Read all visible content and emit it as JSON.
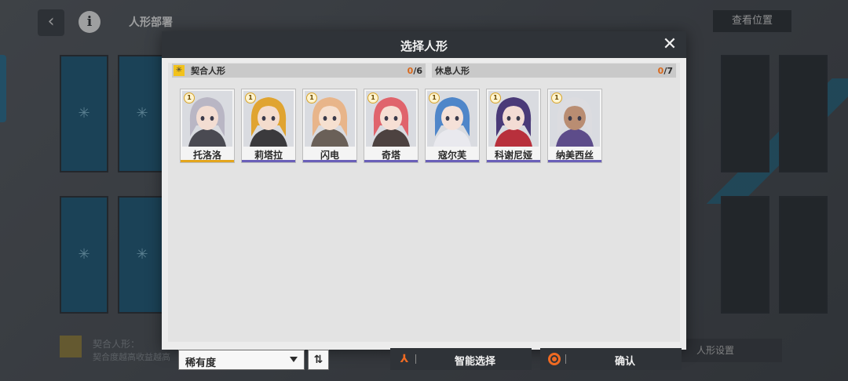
{
  "background": {
    "title": "人形部署",
    "view_position_label": "查看位置",
    "bottom_text_1": "契合人形：",
    "bottom_text_2": "契合度越高收益越高",
    "bottom_button_label": "人形设置"
  },
  "modal": {
    "title": "选择人形",
    "close_glyph": "✕"
  },
  "sections": {
    "fit": {
      "label": "契合人形",
      "selected": "0",
      "total": "/6"
    },
    "rest": {
      "label": "休息人形",
      "selected": "0",
      "total": "/7"
    }
  },
  "dolls": [
    {
      "name": "托洛洛",
      "rank": "1",
      "accent": "#e3a51d",
      "hair": "#b9b6c4",
      "skin": "#f3ddd2",
      "outfit": "#4a4a52"
    },
    {
      "name": "莉塔拉",
      "rank": "1",
      "accent": "#6a5fb8",
      "hair": "#e0a431",
      "skin": "#f4dccd",
      "outfit": "#3b3a3d"
    },
    {
      "name": "闪电",
      "rank": "1",
      "accent": "#6a5fb8",
      "hair": "#e8b58a",
      "skin": "#f6e0d0",
      "outfit": "#6a6058"
    },
    {
      "name": "奇塔",
      "rank": "1",
      "accent": "#6a5fb8",
      "hair": "#e0646c",
      "skin": "#f6dfd4",
      "outfit": "#4d4240"
    },
    {
      "name": "寇尔芙",
      "rank": "1",
      "accent": "#6a5fb8",
      "hair": "#4f86c9",
      "skin": "#f5e1d8",
      "outfit": "#e9e9ee"
    },
    {
      "name": "科谢尼娅",
      "rank": "1",
      "accent": "#6a5fb8",
      "hair": "#4a3a78",
      "skin": "#f3dcd4",
      "outfit": "#b8303c"
    },
    {
      "name": "纳美西丝",
      "rank": "1",
      "accent": "#6a5fb8",
      "hair": "#dcdce0",
      "skin": "#b98d72",
      "outfit": "#5d4c8a"
    }
  ],
  "controls": {
    "sort_label": "稀有度",
    "sort_order_glyph": "⇅",
    "smart_select_label": "智能选择",
    "smart_select_icon": "⅄",
    "confirm_label": "确认"
  },
  "colors": {
    "accent_orange": "#ef6a22",
    "gold": "#e3a51d",
    "purple": "#6a5fb8",
    "header_dark": "#2f3338"
  }
}
